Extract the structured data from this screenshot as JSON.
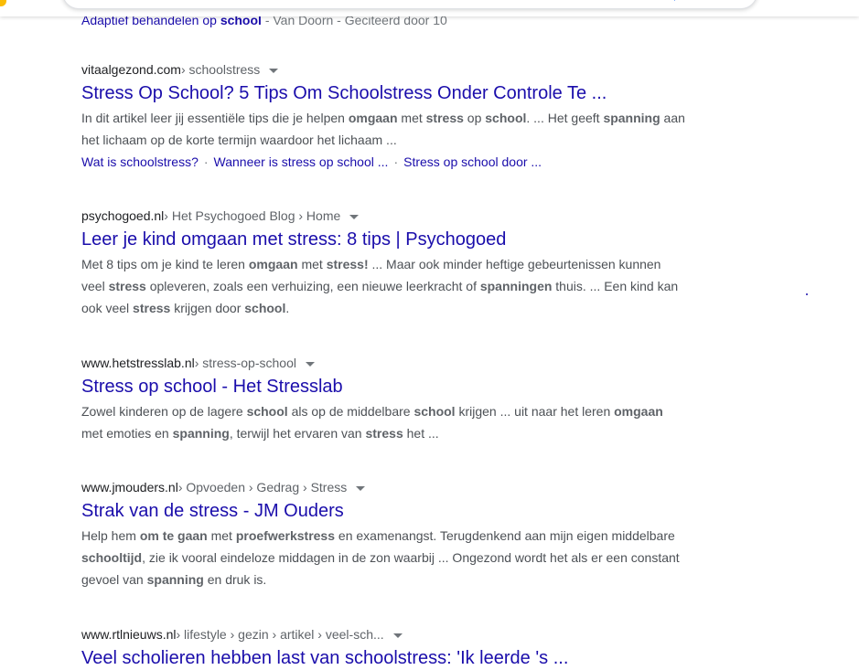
{
  "partial_result": {
    "link": "Adaptief behandelen op ",
    "link_bold": "school",
    "meta": " - Van Doorn - Geciteerd door 10"
  },
  "results": [
    {
      "domain": "vitaalgezond.com",
      "path": " › schoolstress",
      "title": "Stress Op School? 5 Tips Om Schoolstress Onder Controle Te ...",
      "snippet": [
        {
          "t": "In dit artikel leer jij essentiële tips die je helpen "
        },
        {
          "t": "omgaan",
          "b": true
        },
        {
          "t": " met "
        },
        {
          "t": "stress",
          "b": true
        },
        {
          "t": " op "
        },
        {
          "t": "school",
          "b": true
        },
        {
          "t": ". ... Het geeft "
        },
        {
          "t": "spanning",
          "b": true
        },
        {
          "t": " aan het lichaam op de korte termijn waardoor het lichaam ..."
        }
      ],
      "sitelinks": [
        "Wat is schoolstress?",
        "Wanneer is stress op school ...",
        "Stress op school door ..."
      ]
    },
    {
      "domain": "psychogoed.nl",
      "path": " › Het Psychogoed Blog › Home",
      "title": "Leer je kind omgaan met stress: 8 tips | Psychogoed",
      "snippet": [
        {
          "t": "Met 8 tips om je kind te leren "
        },
        {
          "t": "omgaan",
          "b": true
        },
        {
          "t": " met "
        },
        {
          "t": "stress!",
          "b": true
        },
        {
          "t": " ... Maar ook minder heftige gebeurtenissen kunnen veel "
        },
        {
          "t": "stress",
          "b": true
        },
        {
          "t": " opleveren, zoals een verhuizing, een nieuwe leerkracht of "
        },
        {
          "t": "spanningen",
          "b": true
        },
        {
          "t": " thuis. ... Een kind kan ook veel "
        },
        {
          "t": "stress",
          "b": true
        },
        {
          "t": " krijgen door "
        },
        {
          "t": "school",
          "b": true
        },
        {
          "t": "."
        }
      ]
    },
    {
      "domain": "www.hetstresslab.nl",
      "path": " › stress-op-school",
      "title": "Stress op school - Het Stresslab",
      "snippet": [
        {
          "t": "Zowel kinderen op de lagere "
        },
        {
          "t": "school",
          "b": true
        },
        {
          "t": " als op de middelbare "
        },
        {
          "t": "school",
          "b": true
        },
        {
          "t": " krijgen ... uit naar het leren "
        },
        {
          "t": "omgaan",
          "b": true
        },
        {
          "t": " met emoties en "
        },
        {
          "t": "spanning",
          "b": true
        },
        {
          "t": ", terwijl het ervaren van "
        },
        {
          "t": "stress",
          "b": true
        },
        {
          "t": " het ..."
        }
      ]
    },
    {
      "domain": "www.jmouders.nl",
      "path": " › Opvoeden › Gedrag › Stress",
      "title": "Strak van de stress - JM Ouders",
      "snippet": [
        {
          "t": "Help hem "
        },
        {
          "t": "om te gaan",
          "b": true
        },
        {
          "t": " met "
        },
        {
          "t": "proefwerkstress",
          "b": true
        },
        {
          "t": " en examenangst. Terugdenkend aan mijn eigen middelbare "
        },
        {
          "t": "schooltijd",
          "b": true
        },
        {
          "t": ", zie ik vooral eindeloze middagen in de zon waarbij ... Ongezond wordt het als er een constant gevoel van "
        },
        {
          "t": "spanning",
          "b": true
        },
        {
          "t": " en druk is."
        }
      ]
    },
    {
      "domain": "www.rtlnieuws.nl",
      "path": " › lifestyle › gezin › artikel › veel-sch...",
      "title": "Veel scholieren hebben last van schoolstress: 'Ik leerde 's ...",
      "snippet": []
    }
  ],
  "colors": {
    "link": "#1a0dab",
    "cite": "#202124",
    "snippet": "#4d5156"
  }
}
